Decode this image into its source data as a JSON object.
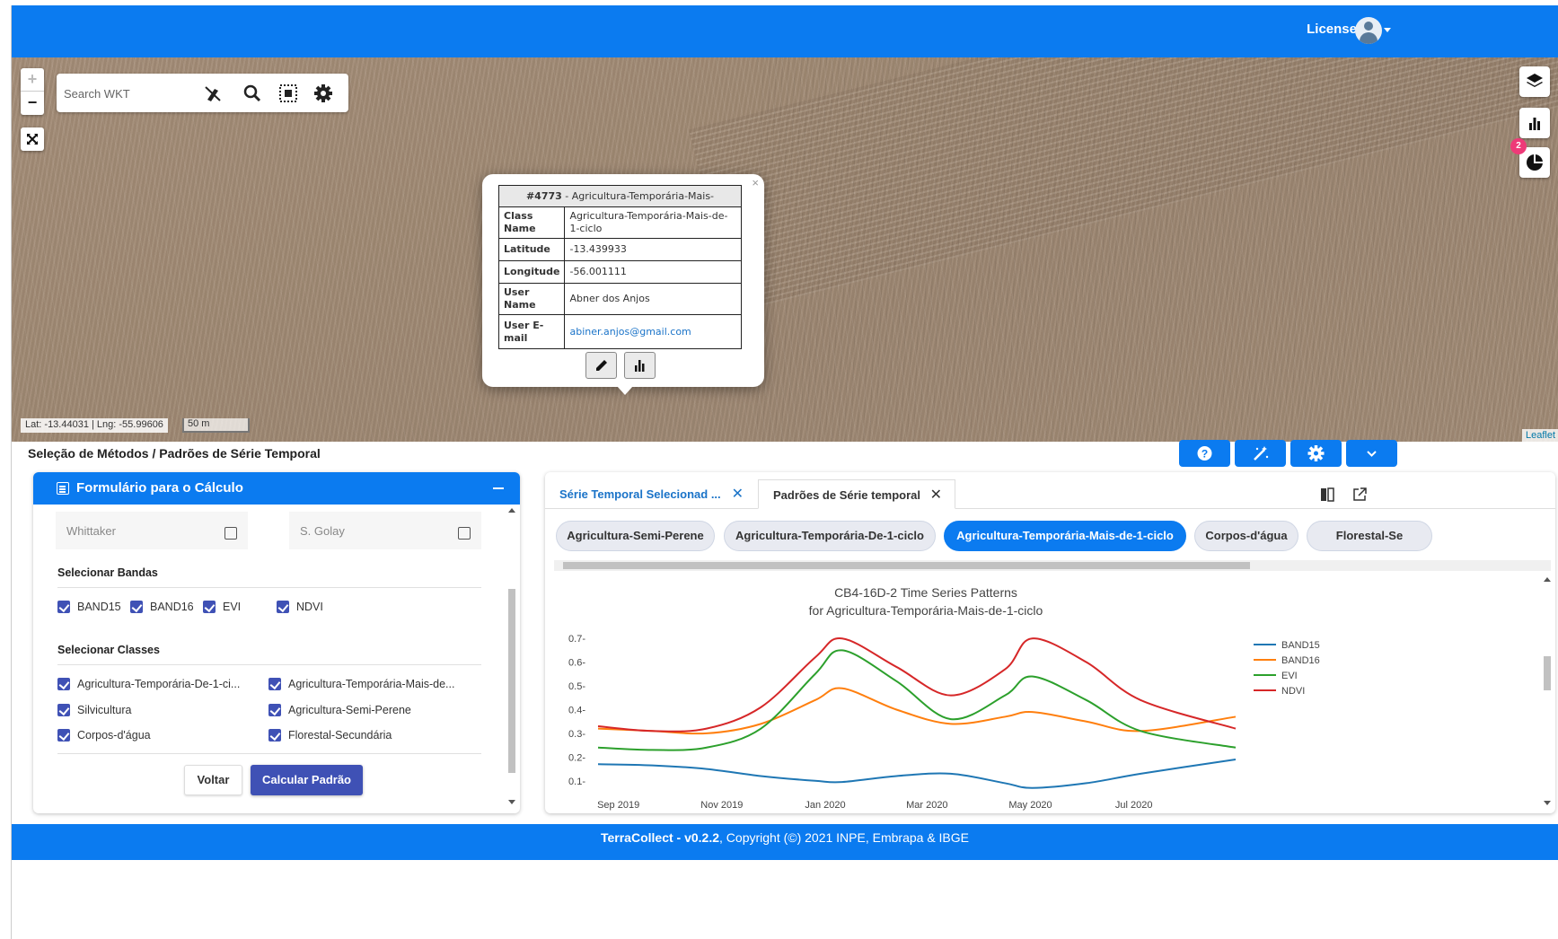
{
  "header": {
    "license_label": "License"
  },
  "map": {
    "search_placeholder": "Search WKT",
    "zoom_in": "+",
    "zoom_out": "−",
    "fullscreen": "⛶",
    "coords": "Lat: -13.44031 | Lng: -55.99606",
    "scale": "50 m",
    "attribution": "Leaflet",
    "badge_count": "2"
  },
  "popup": {
    "title_id": "#4773",
    "title_class": "Agricultura-Temporária-Mais-",
    "rows": [
      {
        "key": "Class Name",
        "value": "Agricultura-Temporária-Mais-de-1-ciclo"
      },
      {
        "key": "Latitude",
        "value": "-13.439933"
      },
      {
        "key": "Longitude",
        "value": "-56.001111"
      },
      {
        "key": "User Name",
        "value": "Abner dos Anjos"
      },
      {
        "key": "User E-mail",
        "value": "abiner.anjos@gmail.com"
      }
    ],
    "close": "×"
  },
  "panel": {
    "title": "Seleção de Métodos / Padrões de Série Temporal"
  },
  "form": {
    "title": "Formulário para o Cálculo",
    "smoothing": [
      {
        "label": "Whittaker",
        "checked": false
      },
      {
        "label": "S. Golay",
        "checked": false
      }
    ],
    "bands_label": "Selecionar Bandas",
    "bands": [
      "BAND15",
      "BAND16",
      "EVI",
      "NDVI"
    ],
    "classes_label": "Selecionar Classes",
    "classes": [
      "Agricultura-Temporária-De-1-ci...",
      "Agricultura-Temporária-Mais-de...",
      "Silvicultura",
      "Agricultura-Semi-Perene",
      "Corpos-d'água",
      "Florestal-Secundária"
    ],
    "back_label": "Voltar",
    "calc_label": "Calcular Padrão"
  },
  "chart_panel": {
    "tabs": [
      {
        "label": "Série Temporal Selecionad ...",
        "close": "✕"
      },
      {
        "label": "Padrões de Série temporal",
        "close": "✕"
      }
    ],
    "chips": [
      "Agricultura-Semi-Perene",
      "Agricultura-Temporária-De-1-ciclo",
      "Agricultura-Temporária-Mais-de-1-ciclo",
      "Corpos-d'água",
      "Florestal-Se"
    ],
    "active_chip": 2
  },
  "chart_data": {
    "type": "line",
    "title": "CB4-16D-2 Time Series Patterns",
    "subtitle": "for Agricultura-Temporária-Mais-de-1-ciclo",
    "xlabel": "",
    "ylabel": "",
    "x_range": [
      "2019-08-20",
      "2020-08-30"
    ],
    "x_ticks": [
      "Sep 2019",
      "Nov 2019",
      "Jan 2020",
      "Mar 2020",
      "May 2020",
      "Jul 2020"
    ],
    "x_tick_dates": [
      "2019-09-01",
      "2019-11-01",
      "2020-01-01",
      "2020-03-01",
      "2020-05-01",
      "2020-07-01"
    ],
    "ylim": [
      0.05,
      0.75
    ],
    "y_ticks": [
      0.1,
      0.2,
      0.3,
      0.4,
      0.5,
      0.6,
      0.7
    ],
    "y_tick_labels": [
      "0.1-",
      "0.2-",
      "0.3-",
      "0.4-",
      "0.5-",
      "0.6-",
      "0.7-"
    ],
    "grid": false,
    "legend": "right",
    "x": [
      "2019-08-20",
      "2019-09-21",
      "2019-10-23",
      "2019-11-24",
      "2019-12-26",
      "2020-01-11",
      "2020-02-12",
      "2020-03-15",
      "2020-04-16",
      "2020-05-02",
      "2020-06-03",
      "2020-07-05",
      "2020-08-30"
    ],
    "series": [
      {
        "name": "BAND15",
        "color": "#1f77b4",
        "values": [
          0.17,
          0.165,
          0.15,
          0.12,
          0.1,
          0.095,
          0.12,
          0.13,
          0.09,
          0.07,
          0.09,
          0.13,
          0.19
        ]
      },
      {
        "name": "BAND16",
        "color": "#ff7f0e",
        "values": [
          0.32,
          0.31,
          0.3,
          0.34,
          0.44,
          0.49,
          0.4,
          0.34,
          0.37,
          0.39,
          0.35,
          0.31,
          0.37
        ]
      },
      {
        "name": "EVI",
        "color": "#2ca02c",
        "values": [
          0.24,
          0.23,
          0.24,
          0.32,
          0.55,
          0.65,
          0.52,
          0.36,
          0.46,
          0.54,
          0.44,
          0.31,
          0.24
        ]
      },
      {
        "name": "NDVI",
        "color": "#d62728",
        "values": [
          0.33,
          0.31,
          0.32,
          0.41,
          0.62,
          0.7,
          0.58,
          0.46,
          0.57,
          0.7,
          0.6,
          0.44,
          0.32
        ]
      }
    ]
  },
  "footer": {
    "brand": "TerraCollect - v0.2.2",
    "copyright": ", Copyright (©) 2021 INPE, Embrapa & IBGE"
  }
}
